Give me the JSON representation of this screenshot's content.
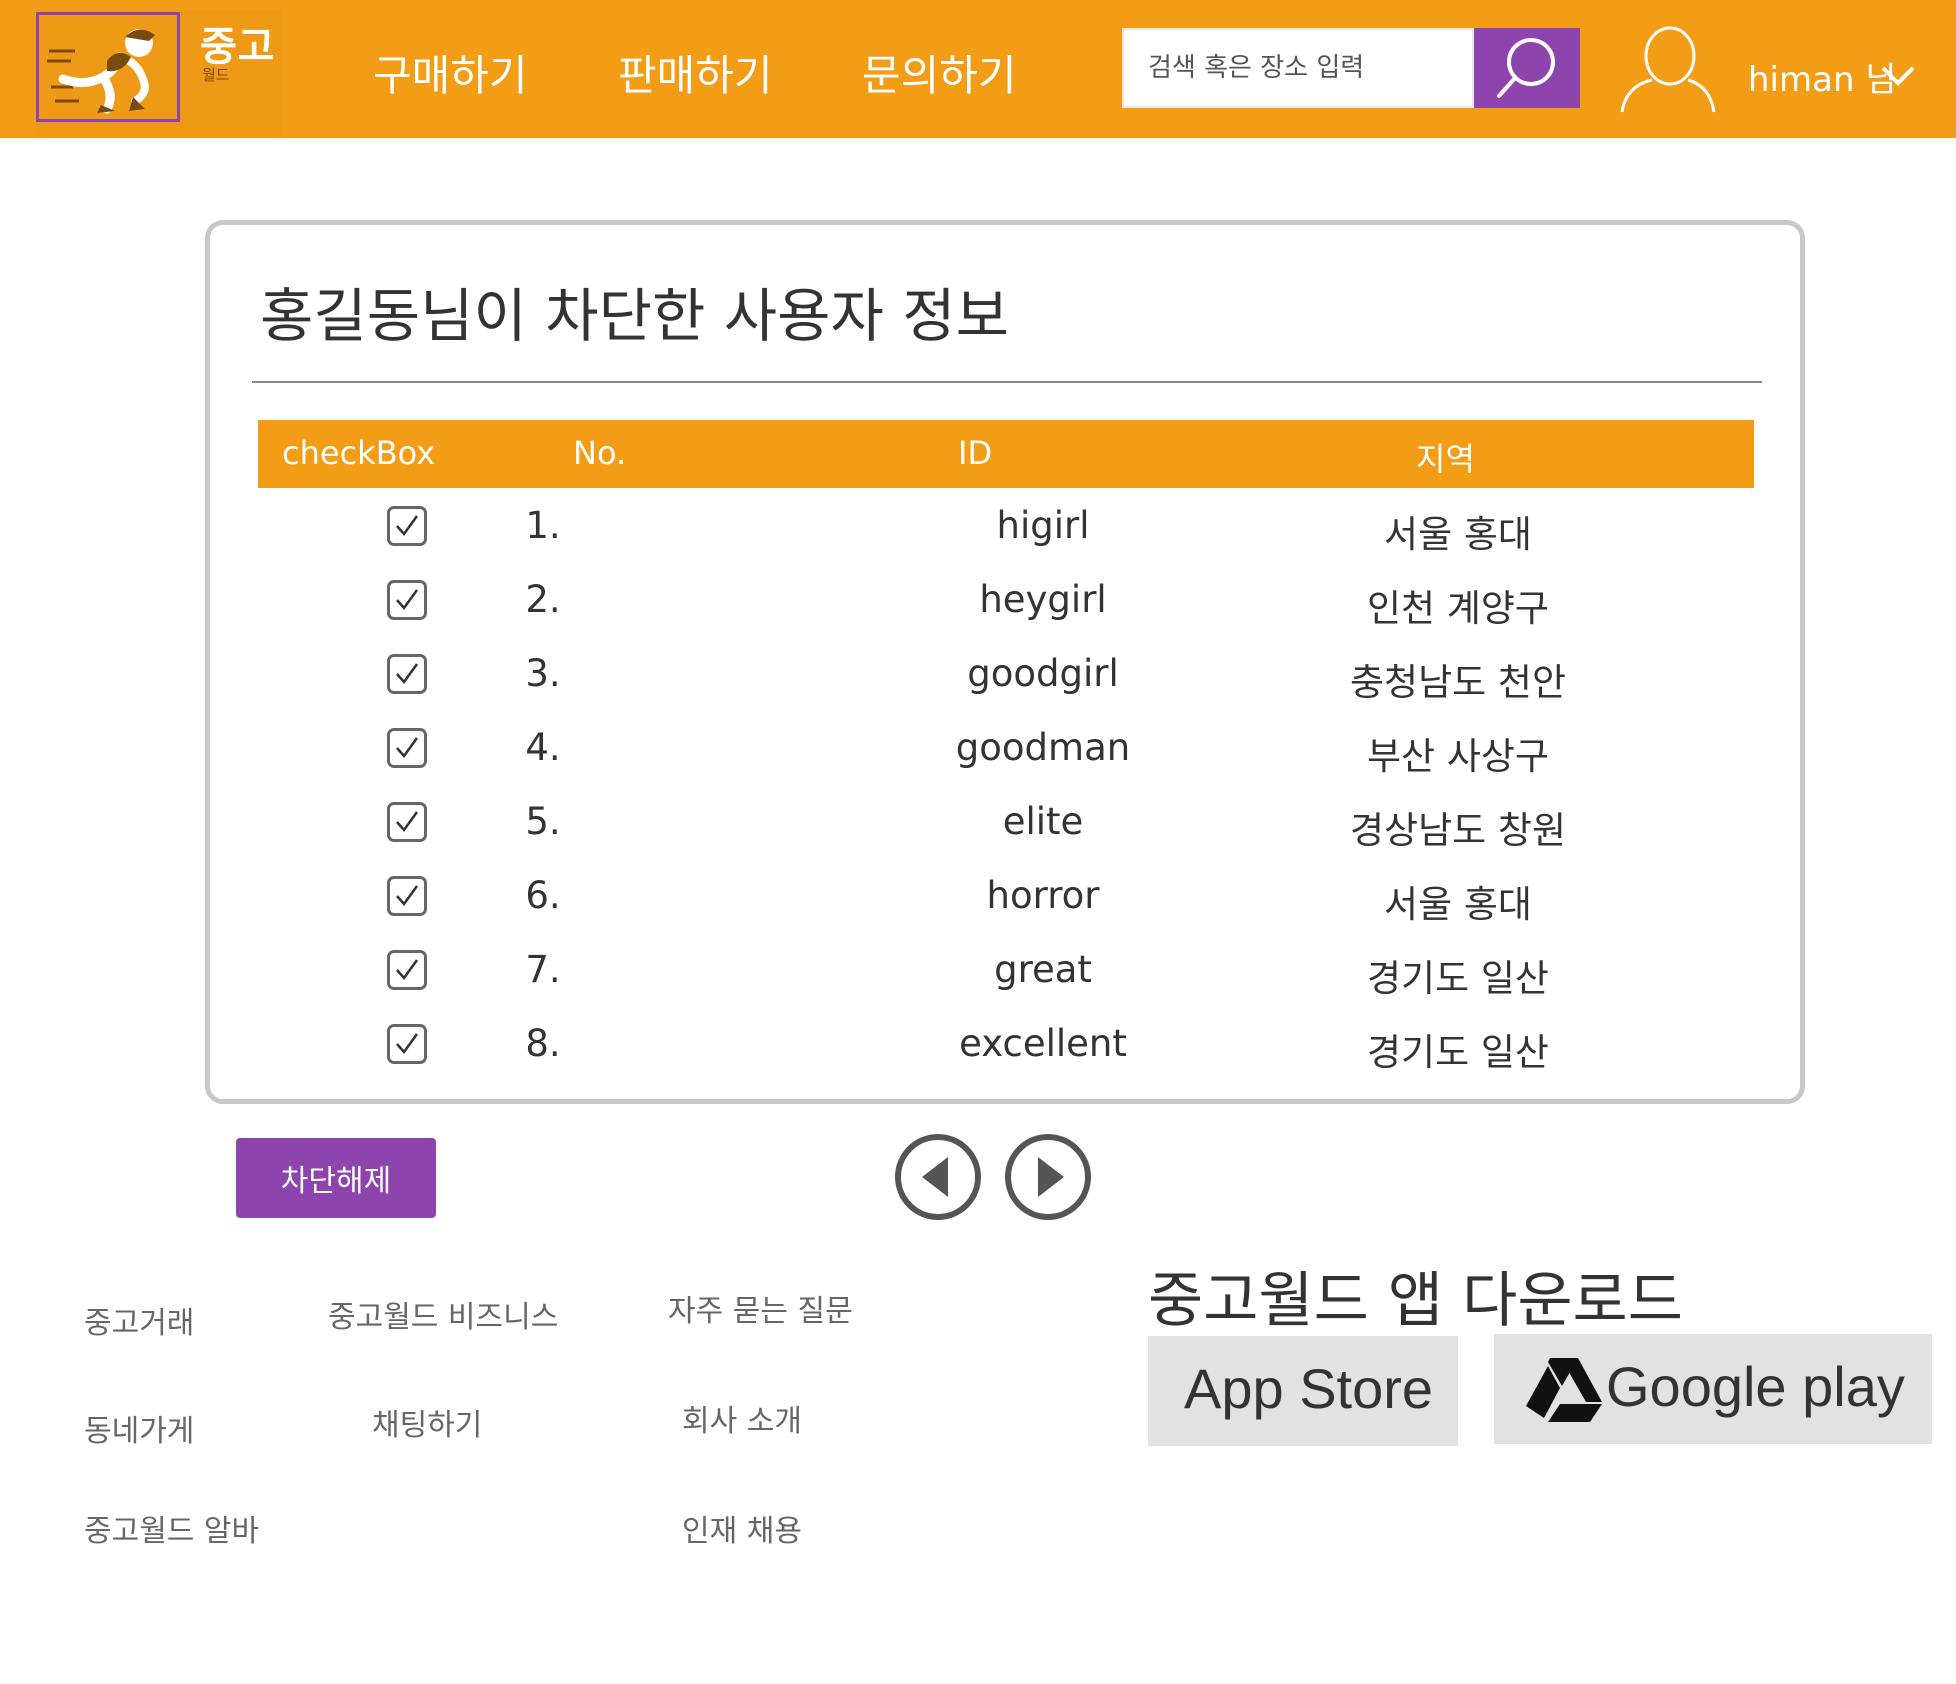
{
  "header": {
    "logo": {
      "text": "중고",
      "sub": "월드"
    },
    "nav": [
      "구매하기",
      "판매하기",
      "문의하기"
    ],
    "search": {
      "placeholder": "검색 혹은 장소 입력",
      "icon": "search-icon"
    },
    "user": {
      "name": "himan 님",
      "icon": "user-icon",
      "dropdown_icon": "chevron-down-icon"
    },
    "colors": {
      "header_bg": "#f39c16",
      "accent": "#8e44ad"
    }
  },
  "panel": {
    "title": "홍길동님이 차단한 사용자 정보",
    "columns": [
      "checkBox",
      "No.",
      "ID",
      "지역"
    ],
    "rows": [
      {
        "checked": true,
        "no": "1.",
        "id": "higirl",
        "region": "서울 홍대"
      },
      {
        "checked": true,
        "no": "2.",
        "id": "heygirl",
        "region": "인천 계양구"
      },
      {
        "checked": true,
        "no": "3.",
        "id": "goodgirl",
        "region": "충청남도 천안"
      },
      {
        "checked": true,
        "no": "4.",
        "id": "goodman",
        "region": "부산 사상구"
      },
      {
        "checked": true,
        "no": "5.",
        "id": "elite",
        "region": "경상남도 창원"
      },
      {
        "checked": true,
        "no": "6.",
        "id": "horror",
        "region": "서울 홍대"
      },
      {
        "checked": true,
        "no": "7.",
        "id": "great",
        "region": "경기도 일산"
      },
      {
        "checked": true,
        "no": "8.",
        "id": "excellent",
        "region": "경기도 일산"
      }
    ]
  },
  "actions": {
    "unblock_label": "차단해제",
    "prev_icon": "prev-page-icon",
    "next_icon": "next-page-icon"
  },
  "footer": {
    "col1": [
      "중고거래",
      "동네가게",
      "중고월드 알바"
    ],
    "col2": [
      "중고월드 비즈니스",
      "채팅하기"
    ],
    "col3": [
      "자주 묻는 질문",
      "회사 소개",
      "인재 채용"
    ],
    "download": {
      "title": "중고월드 앱 다운로드",
      "app_store": "App Store",
      "google_play": "Google play",
      "google_play_icon": "google-drive-icon"
    }
  }
}
